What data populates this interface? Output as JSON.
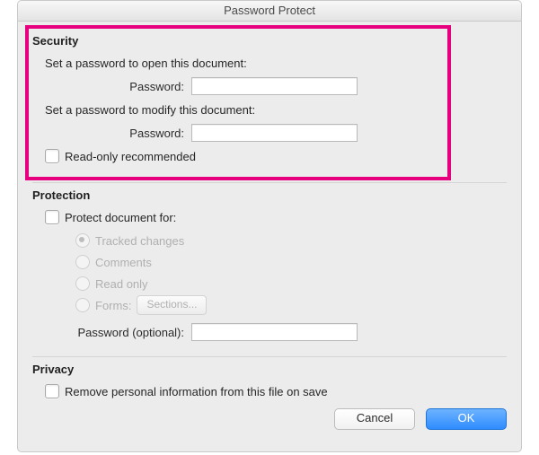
{
  "window": {
    "title": "Password Protect"
  },
  "security": {
    "title": "Security",
    "open_prompt": "Set a password to open this document:",
    "open_label": "Password:",
    "open_value": "",
    "modify_prompt": "Set a password to modify this document:",
    "modify_label": "Password:",
    "modify_value": "",
    "readonly_label": "Read-only recommended"
  },
  "protection": {
    "title": "Protection",
    "protect_for_label": "Protect document for:",
    "options": {
      "tracked": "Tracked changes",
      "comments": "Comments",
      "readonly": "Read only",
      "forms": "Forms:",
      "sections_btn": "Sections..."
    },
    "password_label": "Password (optional):",
    "password_value": ""
  },
  "privacy": {
    "title": "Privacy",
    "remove_label": "Remove personal information from this file on save"
  },
  "buttons": {
    "cancel": "Cancel",
    "ok": "OK"
  }
}
